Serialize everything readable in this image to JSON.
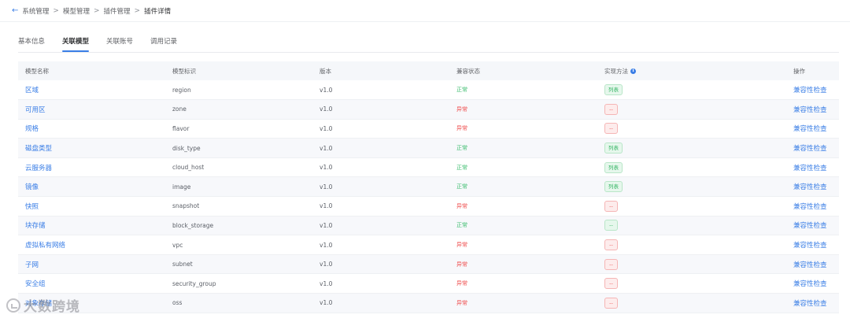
{
  "breadcrumb": {
    "back_icon": "←",
    "items": [
      "系统管理",
      "模型管理",
      "插件管理",
      "插件详情"
    ],
    "separator": ">"
  },
  "tabs": [
    {
      "label": "基本信息",
      "active": false
    },
    {
      "label": "关联模型",
      "active": true
    },
    {
      "label": "关联账号",
      "active": false
    },
    {
      "label": "调用记录",
      "active": false
    }
  ],
  "table": {
    "headers": {
      "name": "模型名称",
      "id": "模型标识",
      "version": "版本",
      "compat": "兼容状态",
      "impl": "实现方法",
      "impl_info_icon": "i",
      "op": "操作"
    },
    "rows": [
      {
        "name": "区域",
        "id": "region",
        "version": "v1.0",
        "status": "正常",
        "status_ok": true,
        "impl": "列表",
        "op": "兼容性检查"
      },
      {
        "name": "可用区",
        "id": "zone",
        "version": "v1.0",
        "status": "异常",
        "status_ok": false,
        "impl": "--",
        "op": "兼容性检查"
      },
      {
        "name": "规格",
        "id": "flavor",
        "version": "v1.0",
        "status": "异常",
        "status_ok": false,
        "impl": "--",
        "op": "兼容性检查"
      },
      {
        "name": "磁盘类型",
        "id": "disk_type",
        "version": "v1.0",
        "status": "正常",
        "status_ok": true,
        "impl": "列表",
        "op": "兼容性检查"
      },
      {
        "name": "云服务器",
        "id": "cloud_host",
        "version": "v1.0",
        "status": "正常",
        "status_ok": true,
        "impl": "列表",
        "op": "兼容性检查"
      },
      {
        "name": "镜像",
        "id": "image",
        "version": "v1.0",
        "status": "正常",
        "status_ok": true,
        "impl": "列表",
        "op": "兼容性检查"
      },
      {
        "name": "快照",
        "id": "snapshot",
        "version": "v1.0",
        "status": "异常",
        "status_ok": false,
        "impl": "--",
        "op": "兼容性检查"
      },
      {
        "name": "块存储",
        "id": "block_storage",
        "version": "v1.0",
        "status": "正常",
        "status_ok": true,
        "impl": "--",
        "op": "兼容性检查"
      },
      {
        "name": "虚拟私有网络",
        "id": "vpc",
        "version": "v1.0",
        "status": "异常",
        "status_ok": false,
        "impl": "--",
        "op": "兼容性检查"
      },
      {
        "name": "子网",
        "id": "subnet",
        "version": "v1.0",
        "status": "异常",
        "status_ok": false,
        "impl": "--",
        "op": "兼容性检查"
      },
      {
        "name": "安全组",
        "id": "security_group",
        "version": "v1.0",
        "status": "异常",
        "status_ok": false,
        "impl": "--",
        "op": "兼容性检查"
      },
      {
        "name": "对象存储",
        "id": "oss",
        "version": "v1.0",
        "status": "异常",
        "status_ok": false,
        "impl": "--",
        "op": "兼容性检查"
      }
    ]
  },
  "watermark": {
    "text": "大数跨境"
  },
  "colors": {
    "accent": "#3a7ee6",
    "ok": "#3dbd6f",
    "bad": "#ef4d4d"
  }
}
